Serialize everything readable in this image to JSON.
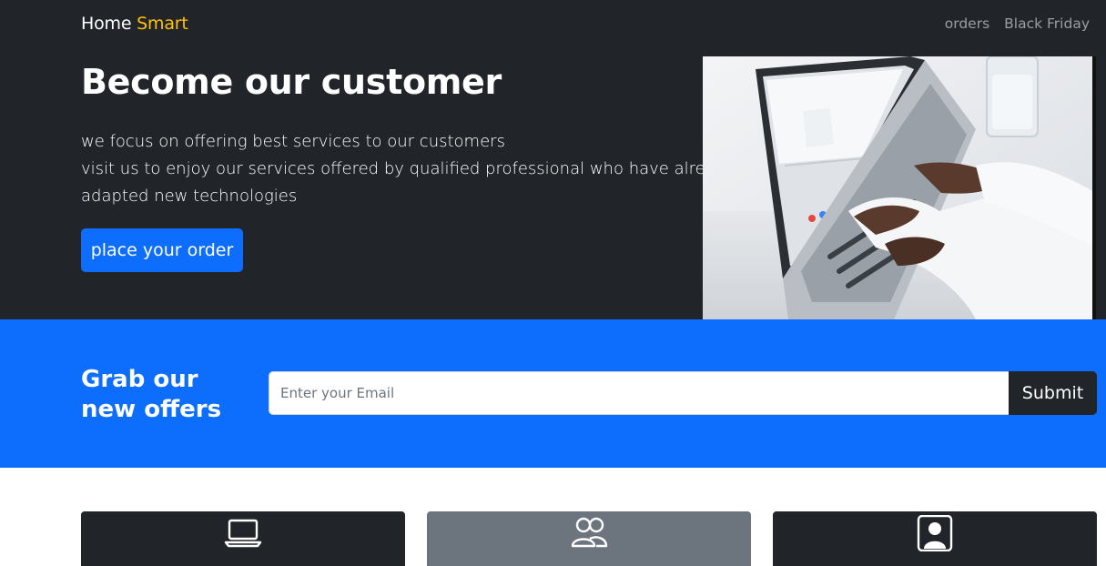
{
  "navbar": {
    "brand_main": "Home",
    "brand_accent": "Smart",
    "links": [
      "orders",
      "Black Friday"
    ]
  },
  "hero": {
    "title": "Become our customer",
    "lines": [
      "we focus on offering best services to our customers",
      "visit us to enjoy our services offered by qualified professional who have already",
      "adapted new technologies"
    ],
    "button_label": "place your order",
    "image_icon": "laptop-typing-photo"
  },
  "offers": {
    "title": "Grab our new offers",
    "email_placeholder": "Enter your Email",
    "email_value": "",
    "submit_label": "Submit"
  },
  "cards": [
    {
      "icon": "laptop-icon"
    },
    {
      "icon": "people-icon"
    },
    {
      "icon": "person-square-icon"
    }
  ],
  "colors": {
    "dark": "#212529",
    "primary": "#0d6efd",
    "accent": "#ffc107",
    "secondary": "#6c757d"
  }
}
